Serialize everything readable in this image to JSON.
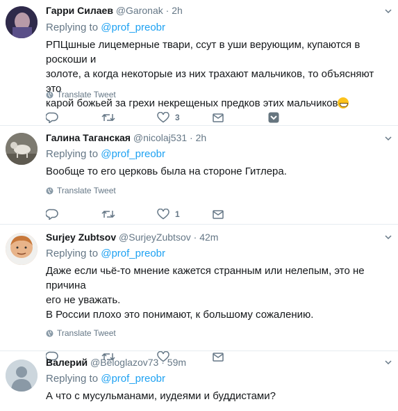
{
  "tweets": [
    {
      "name": "Гарри Силаев",
      "handle": "@Garonak",
      "dot": "·",
      "time": "2h",
      "replying_prefix": "Replying to",
      "replying_to": "@prof_preobr",
      "text_lines": [
        "РПЦшные лицемерные твари, ссут в уши верующим, купаются в роскоши и",
        "золоте, а когда некоторые из них трахают мальчиков, то объясняют это",
        "карой божьей за грехи некрещеных предков этих мальчиков"
      ],
      "emoji": "grinning-face",
      "translate": "Translate Tweet",
      "likes": "3",
      "avatar_color": "#4a3c6e"
    },
    {
      "name": "Галина Таганская",
      "handle": "@nicolaj531",
      "dot": "·",
      "time": "2h",
      "replying_prefix": "Replying to",
      "replying_to": "@prof_preobr",
      "text_lines": [
        "Вообще то его церковь была на стороне Гитлера."
      ],
      "translate": "Translate Tweet",
      "likes": "1",
      "avatar_color": "#8a8a80"
    },
    {
      "name": "Surjey Zubtsov",
      "handle": "@SurjeyZubtsov",
      "dot": "·",
      "time": "42m",
      "replying_prefix": "Replying to",
      "replying_to": "@prof_preobr",
      "text_lines": [
        "Даже если чьё-то мнение кажется странным или нелепым, это не причина",
        "его не уважать.",
        "В России плохо это понимают, к большому сожалению."
      ],
      "translate": "Translate Tweet",
      "likes": "",
      "avatar_color": "#f2a36b"
    },
    {
      "name": "Валерий",
      "handle": "@Beloglazov73",
      "dot": "·",
      "time": "59m",
      "replying_prefix": "Replying to",
      "replying_to": "@prof_preobr",
      "text_lines": [
        "А что с мусульманами, иудеями и буддистами?"
      ],
      "avatar_color": "#ccd6dd"
    }
  ],
  "colors": {
    "link": "#1da1f2",
    "muted": "#657786",
    "dm_active": "#66757f"
  },
  "icons": [
    "reply-icon",
    "retweet-icon",
    "like-icon",
    "direct-message-icon",
    "dm-active-icon",
    "globe-icon",
    "chevron-down-icon"
  ]
}
